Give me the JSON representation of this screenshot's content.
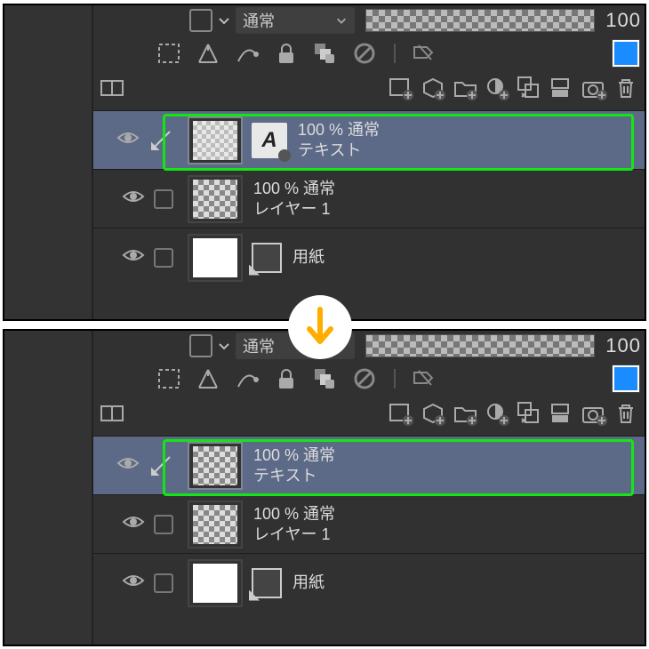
{
  "top": {
    "blend_mode": "通常",
    "opacity": "100",
    "layers": [
      {
        "info": "100 % 通常",
        "name": "テキスト",
        "selected": true,
        "has_text_icon": true,
        "thumb": "textchk"
      },
      {
        "info": "100 % 通常",
        "name": "レイヤー 1",
        "selected": false,
        "has_text_icon": false,
        "thumb": "checker"
      },
      {
        "info": "",
        "name": "用紙",
        "selected": false,
        "has_text_icon": false,
        "thumb": "white",
        "is_paper": true
      }
    ]
  },
  "bottom": {
    "blend_mode": "通常",
    "opacity": "100",
    "layers": [
      {
        "info": "100 % 通常",
        "name": "テキスト",
        "selected": true,
        "has_text_icon": false,
        "thumb": "checker"
      },
      {
        "info": "100 % 通常",
        "name": "レイヤー 1",
        "selected": false,
        "has_text_icon": false,
        "thumb": "checker"
      },
      {
        "info": "",
        "name": "用紙",
        "selected": false,
        "has_text_icon": false,
        "thumb": "white",
        "is_paper": true
      }
    ]
  },
  "icons": {
    "row1": [
      "select-dashed",
      "perspective",
      "curve",
      "lock",
      "checker-lock",
      "color-disable",
      "sep",
      "effect-off"
    ],
    "row2": [
      "panel-split",
      "new-layer",
      "new-3d",
      "new-folder",
      "new-effect",
      "new-copy",
      "merge",
      "new-cam",
      "trash"
    ]
  }
}
